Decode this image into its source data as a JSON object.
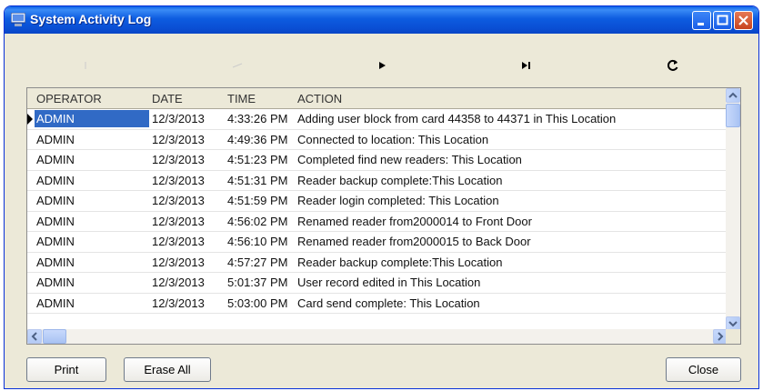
{
  "window": {
    "title": "System Activity Log"
  },
  "toolbar": {
    "buttons": [
      {
        "icon": "first-record-icon"
      },
      {
        "icon": "previous-record-icon"
      },
      {
        "icon": "next-record-icon"
      },
      {
        "icon": "last-record-icon"
      },
      {
        "icon": "refresh-icon"
      }
    ]
  },
  "grid": {
    "columns": [
      "OPERATOR",
      "DATE",
      "TIME",
      "ACTION"
    ],
    "rows": [
      {
        "operator": "ADMIN",
        "date": "12/3/2013",
        "time": "4:33:26 PM",
        "action": "Adding user block from card 44358 to 44371 in This Location"
      },
      {
        "operator": "ADMIN",
        "date": "12/3/2013",
        "time": "4:49:36 PM",
        "action": "Connected to location: This Location"
      },
      {
        "operator": "ADMIN",
        "date": "12/3/2013",
        "time": "4:51:23 PM",
        "action": "Completed find new readers: This Location"
      },
      {
        "operator": "ADMIN",
        "date": "12/3/2013",
        "time": "4:51:31 PM",
        "action": "Reader backup complete:This Location"
      },
      {
        "operator": "ADMIN",
        "date": "12/3/2013",
        "time": "4:51:59 PM",
        "action": "Reader login completed: This Location"
      },
      {
        "operator": "ADMIN",
        "date": "12/3/2013",
        "time": "4:56:02 PM",
        "action": "Renamed reader from2000014 to Front Door"
      },
      {
        "operator": "ADMIN",
        "date": "12/3/2013",
        "time": "4:56:10 PM",
        "action": "Renamed reader from2000015 to Back Door"
      },
      {
        "operator": "ADMIN",
        "date": "12/3/2013",
        "time": "4:57:27 PM",
        "action": "Reader backup complete:This Location"
      },
      {
        "operator": "ADMIN",
        "date": "12/3/2013",
        "time": "5:01:37 PM",
        "action": "User record edited in This Location"
      },
      {
        "operator": "ADMIN",
        "date": "12/3/2013",
        "time": "5:03:00 PM",
        "action": "Card send complete: This Location"
      }
    ]
  },
  "footer": {
    "print_label": "Print",
    "erase_all_label": "Erase All",
    "close_label": "Close"
  },
  "colors": {
    "titlebar": "#0a4fd4",
    "selection": "#316ac5",
    "window_bg": "#ece9d8"
  }
}
